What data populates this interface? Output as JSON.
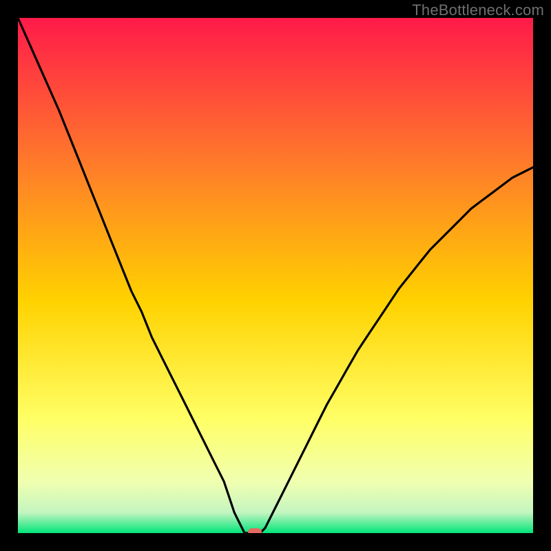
{
  "watermark": "TheBottleneck.com",
  "colors": {
    "frame": "#000000",
    "gradient_top": "#ff1a4a",
    "gradient_mid_upper": "#ff7a2a",
    "gradient_mid": "#ffd200",
    "gradient_mid_lower": "#ffff66",
    "gradient_low1": "#f0ffb0",
    "gradient_low2": "#c4f5c0",
    "gradient_bottom": "#00e57a",
    "curve": "#000000",
    "marker": "#e46a62"
  },
  "chart_data": {
    "type": "line",
    "title": "",
    "xlabel": "",
    "ylabel": "",
    "xlim": [
      0,
      100
    ],
    "ylim": [
      0,
      100
    ],
    "x": [
      0,
      2,
      4,
      6,
      8,
      10,
      12,
      14,
      16,
      18,
      20,
      22,
      24,
      26,
      28,
      30,
      32,
      34,
      36,
      38,
      40,
      41,
      42,
      43,
      44,
      45,
      46,
      47,
      48,
      50,
      52,
      54,
      56,
      58,
      60,
      62,
      64,
      66,
      68,
      70,
      72,
      74,
      76,
      78,
      80,
      82,
      84,
      86,
      88,
      90,
      92,
      94,
      96,
      98,
      100
    ],
    "values": [
      100,
      95.5,
      91,
      86.5,
      82,
      77,
      72,
      67,
      62,
      57,
      52,
      47,
      43,
      38,
      34,
      30,
      26,
      22,
      18,
      14,
      10,
      7,
      4,
      2,
      0,
      0,
      0,
      0,
      1,
      5,
      9,
      13,
      17,
      21,
      25,
      28.5,
      32,
      35.5,
      38.5,
      41.5,
      44.5,
      47.5,
      50,
      52.5,
      55,
      57,
      59,
      61,
      63,
      64.5,
      66,
      67.5,
      69,
      70,
      71
    ],
    "marker": {
      "x": 46,
      "y": 0
    }
  }
}
